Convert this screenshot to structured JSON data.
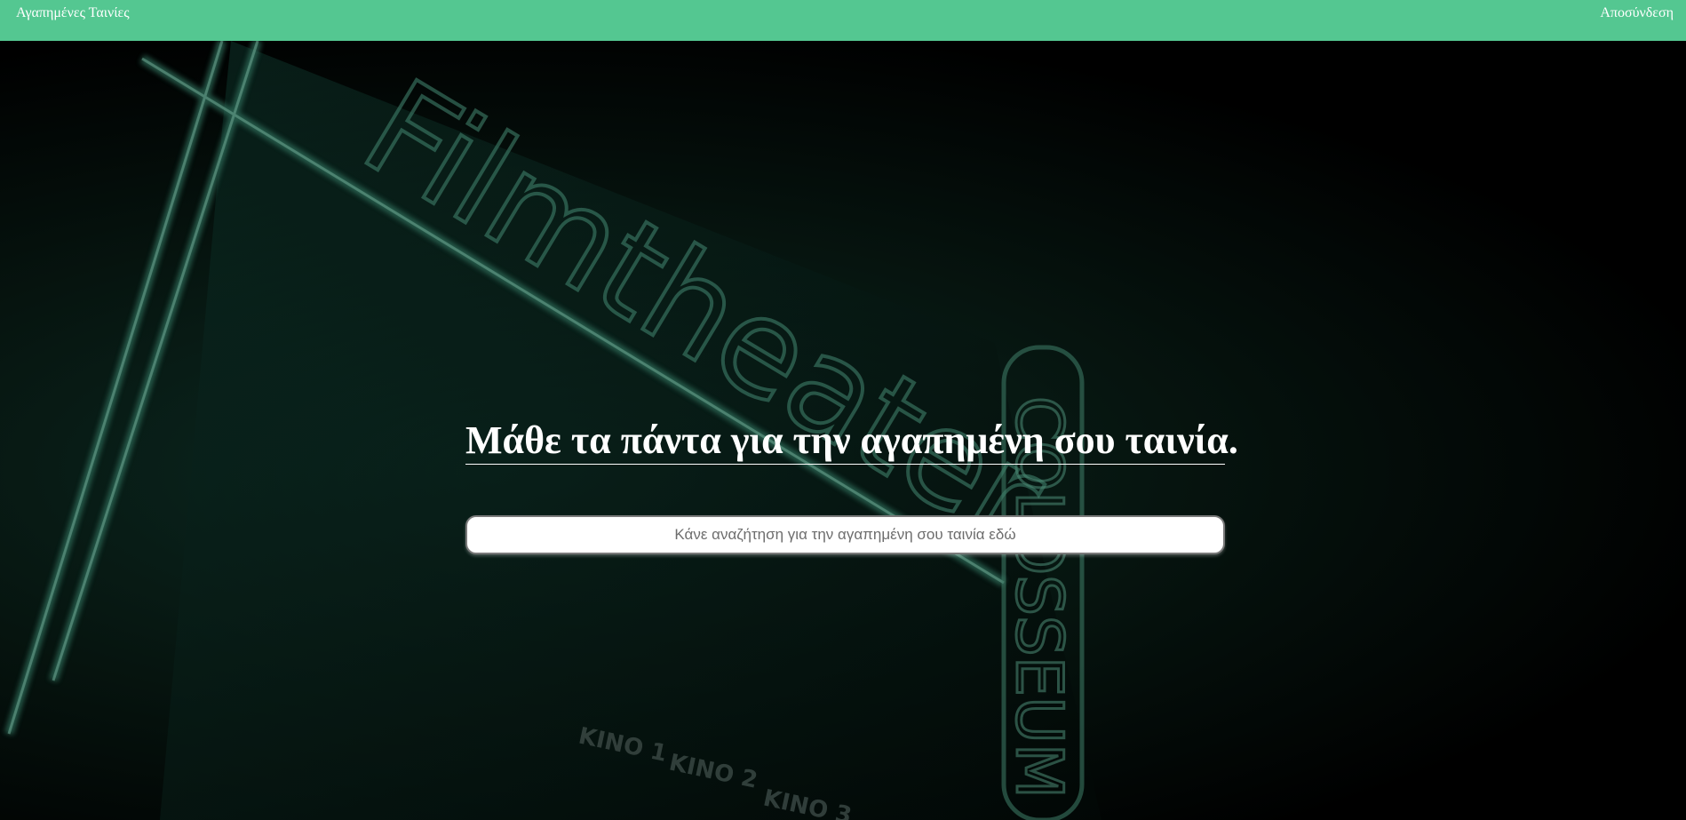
{
  "navbar": {
    "brand_label": "Αγαπημένες Ταινίες",
    "logout_label": "Αποσύνδεση",
    "background_color": "#54c791"
  },
  "hero": {
    "title": "Μάθε τα πάντα για την αγαπημένη σου ταινία.",
    "search_placeholder": "Κάνε αναζήτηση για την αγαπημένη σου ταινία εδώ",
    "background_image": {
      "sign_text": "Filmtheater",
      "vertical_sign_text": "COLOSSEUM",
      "lower_signs": [
        "KINO 1",
        "KINO 2",
        "KINO 3"
      ],
      "tint_color": "#0d3b2e"
    }
  }
}
